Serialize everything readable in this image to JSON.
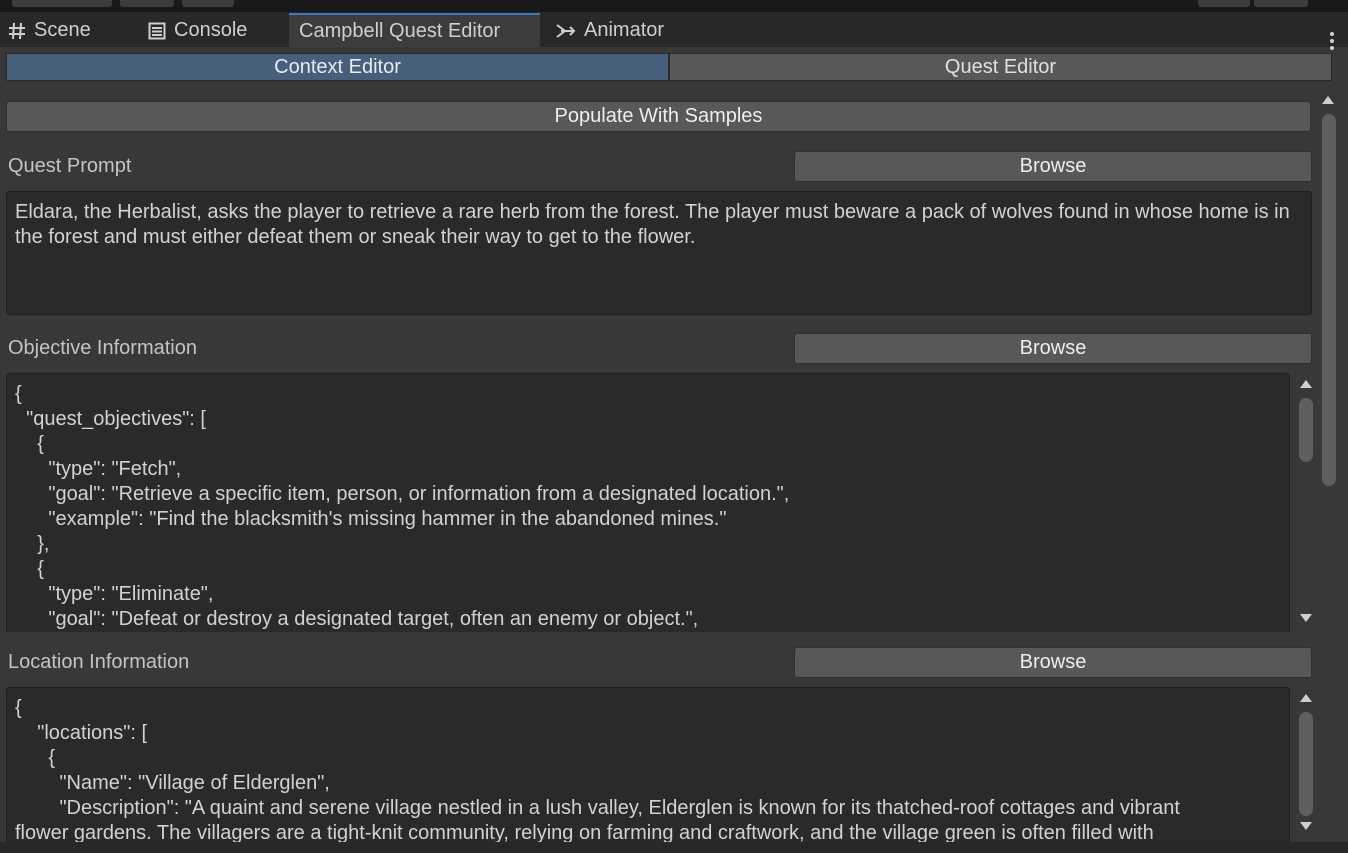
{
  "tabs": [
    {
      "label": "Scene",
      "icon": "grid-icon"
    },
    {
      "label": "Console",
      "icon": "console-icon"
    },
    {
      "label": "Campbell Quest Editor",
      "icon": ""
    },
    {
      "label": "Animator",
      "icon": "animator-icon"
    }
  ],
  "active_tab": "Campbell Quest Editor",
  "mode_toggle": {
    "context_label": "Context Editor",
    "quest_label": "Quest Editor",
    "selected": "Context Editor"
  },
  "populate_button": "Populate With Samples",
  "quest_prompt": {
    "label": "Quest Prompt",
    "browse_label": "Browse",
    "text": "Eldara, the Herbalist, asks the player to retrieve a rare herb from the forest. The player must beware a pack of wolves found in whose home is in the forest and must either defeat them or sneak their way to get to the flower."
  },
  "objective_info": {
    "label": "Objective Information",
    "browse_label": "Browse",
    "text": "{\n  \"quest_objectives\": [\n    {\n      \"type\": \"Fetch\",\n      \"goal\": \"Retrieve a specific item, person, or information from a designated location.\",\n      \"example\": \"Find the blacksmith's missing hammer in the abandoned mines.\"\n    },\n    {\n      \"type\": \"Eliminate\",\n      \"goal\": \"Defeat or destroy a designated target, often an enemy or object.\","
  },
  "location_info": {
    "label": "Location Information",
    "browse_label": "Browse",
    "text": "{\n    \"locations\": [\n      {\n        \"Name\": \"Village of Elderglen\",\n        \"Description\": \"A quaint and serene village nestled in a lush valley, Elderglen is known for its thatched-roof cottages and vibrant\nflower gardens. The villagers are a tight-knit community, relying on farming and craftwork, and the village green is often filled with"
  },
  "colors": {
    "accent": "#3a79bb",
    "selected_toggle": "#46607c",
    "panel_bg": "#383838"
  }
}
